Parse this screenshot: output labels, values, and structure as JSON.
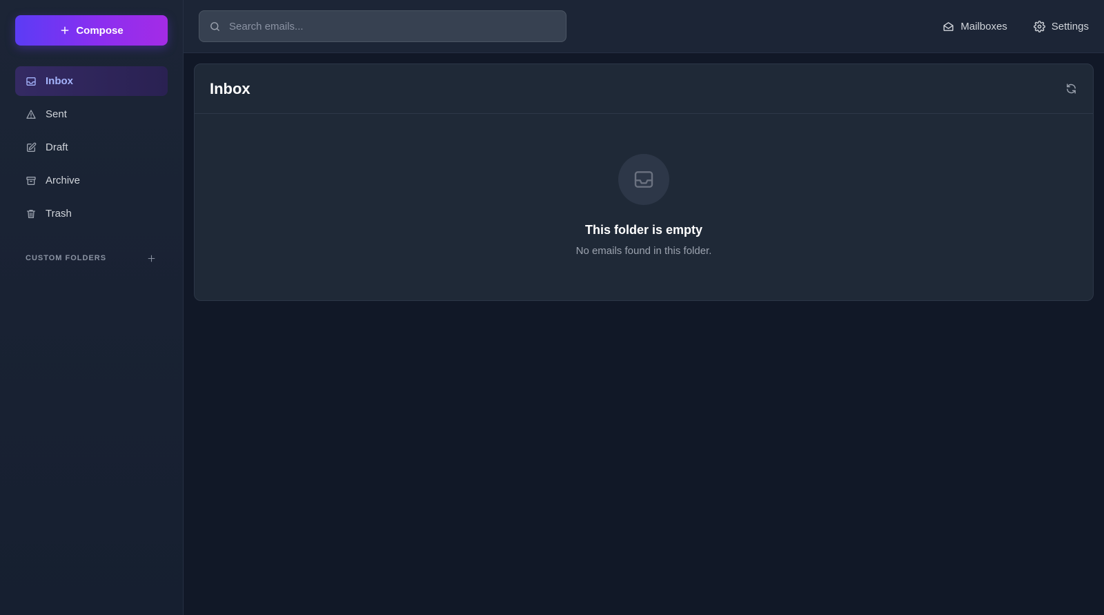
{
  "sidebar": {
    "compose_label": "Compose",
    "nav": [
      {
        "label": "Inbox",
        "icon": "inbox-icon",
        "active": true
      },
      {
        "label": "Sent",
        "icon": "send-icon",
        "active": false
      },
      {
        "label": "Draft",
        "icon": "pencil-icon",
        "active": false
      },
      {
        "label": "Archive",
        "icon": "archive-icon",
        "active": false
      },
      {
        "label": "Trash",
        "icon": "trash-icon",
        "active": false
      }
    ],
    "custom_folders_label": "CUSTOM FOLDERS"
  },
  "topbar": {
    "search_placeholder": "Search emails...",
    "search_value": "",
    "mailboxes_label": "Mailboxes",
    "settings_label": "Settings"
  },
  "panel": {
    "title": "Inbox",
    "empty_title": "This folder is empty",
    "empty_subtitle": "No emails found in this folder."
  },
  "colors": {
    "accent_start": "#5b3cf5",
    "accent_end": "#a42ce6",
    "active_text": "#a5b4fc",
    "background": "#111827"
  }
}
